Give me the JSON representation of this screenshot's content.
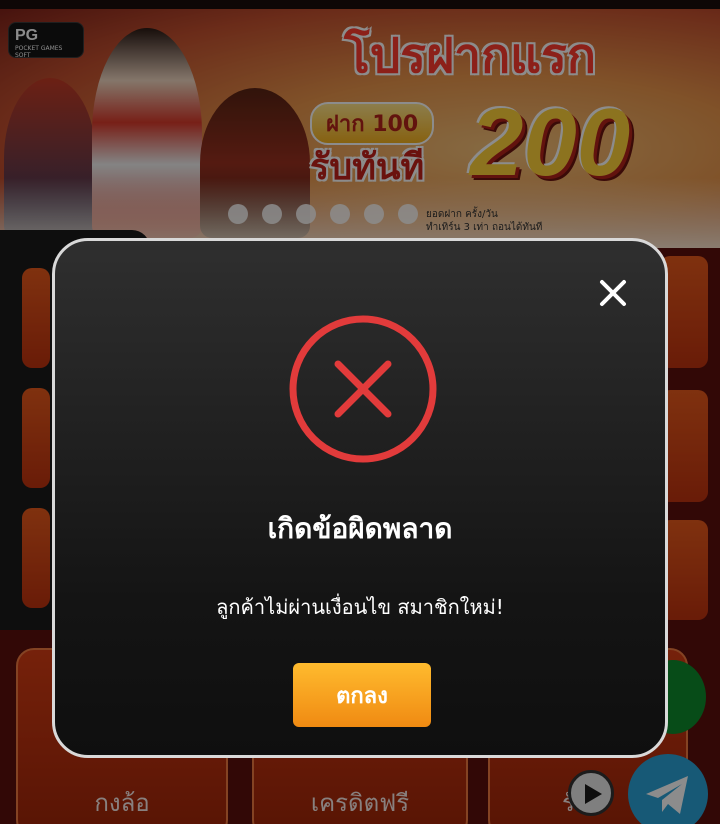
{
  "banner": {
    "logo_text": "PG",
    "logo_subtext": "POCKET GAMES SOFT",
    "promo_title": "โปรฝากแรก",
    "deposit_label": "ฝาก 100",
    "receive_label": "รับทันที",
    "bonus_amount": "200",
    "fine_print_line1": "ยอดฝาก ครั้ง/วัน",
    "fine_print_line2": "ทำเทิร์น 3 เท่า ถอนได้ทันที",
    "slide_count": 6
  },
  "background": {
    "bottom_cards": [
      "กงล้อ",
      "เครดิตฟรี",
      "รับ"
    ]
  },
  "modal": {
    "title": "เกิดข้อผิดพลาด",
    "message": "ลูกค้าไม่ผ่านเงื่อนไข สมาชิกใหม่!",
    "ok_label": "ตกลง",
    "close_icon": "close-icon",
    "status_icon": "error-x-circle-icon",
    "accent_color": "#e23b3b",
    "button_color": "#f5a623"
  }
}
